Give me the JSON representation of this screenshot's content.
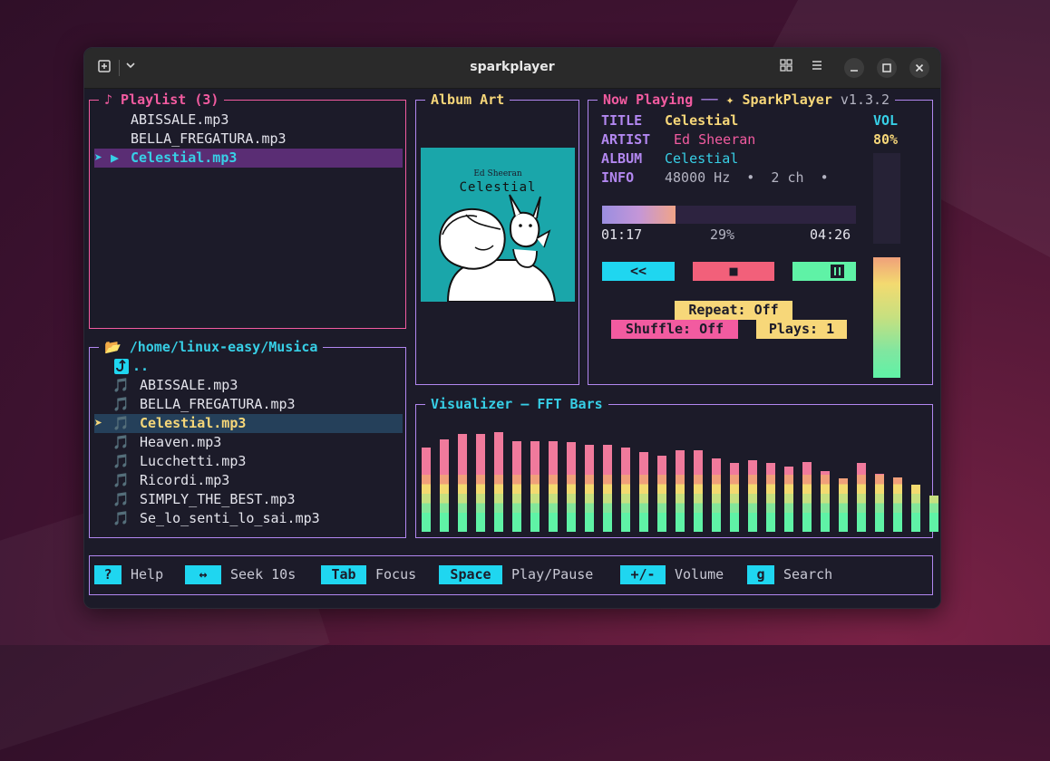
{
  "window": {
    "title": "sparkplayer"
  },
  "playlist": {
    "legend": "♪ Playlist (3)",
    "items": [
      "ABISSALE.mp3",
      "BELLA_FREGATURA.mp3",
      "Celestial.mp3"
    ],
    "selected_marker": "➤ ▶"
  },
  "browser": {
    "legend": "📂 /home/linux-easy/Musica",
    "parent": "..",
    "parent_icon": "return-arrow-icon",
    "files": [
      "ABISSALE.mp3",
      "BELLA_FREGATURA.mp3",
      "Celestial.mp3",
      "Heaven.mp3",
      "Lucchetti.mp3",
      "Ricordi.mp3",
      "SIMPLY_THE_BEST.mp3",
      "Se_lo_senti_lo_sai.mp3"
    ],
    "file_icon": "🎵",
    "cursor": "➤"
  },
  "album": {
    "legend": "Album Art",
    "artist_text": "Ed Sheeran",
    "title_text": "Celestial"
  },
  "now_playing": {
    "legend": "Now Playing",
    "brand": "✦ SparkPlayer",
    "version": "v1.3.2",
    "labels": {
      "title": "TITLE",
      "artist": "ARTIST",
      "album": "ALBUM",
      "info": "INFO"
    },
    "values": {
      "title": "Celestial",
      "artist": "Ed Sheeran",
      "album": "Celestial",
      "info": "48000 Hz  •  2 ch  •"
    },
    "elapsed": "01:17",
    "percent": "29%",
    "duration": "04:26",
    "progress_fraction": 0.29,
    "volume_label": "VOL",
    "volume_value": "80%",
    "volume_fraction": 0.8,
    "controls": {
      "prev": "<<",
      "stop": "■",
      "pause": "⏸"
    },
    "repeat": "Repeat: Off",
    "shuffle": "Shuffle: Off",
    "plays": "Plays: 1"
  },
  "visualizer": {
    "legend": "Visualizer — FFT Bars",
    "levels": [
      0.73,
      0.8,
      0.84,
      0.84,
      0.86,
      0.78,
      0.78,
      0.78,
      0.77,
      0.75,
      0.75,
      0.73,
      0.69,
      0.66,
      0.7,
      0.7,
      0.63,
      0.59,
      0.62,
      0.59,
      0.56,
      0.6,
      0.52,
      0.46,
      0.59,
      0.5,
      0.47,
      0.41,
      0.31
    ]
  },
  "help": [
    {
      "key": "?",
      "label": "Help"
    },
    {
      "key": "↔",
      "label": "Seek 10s"
    },
    {
      "key": "Tab",
      "label": "Focus"
    },
    {
      "key": "Space",
      "label": "Play/Pause"
    },
    {
      "key": "+/-",
      "label": "Volume"
    },
    {
      "key": "g",
      "label": "Search"
    }
  ],
  "colors": {
    "pink": "#f25ba0",
    "yellow": "#f7d779",
    "cyan": "#37cfe6",
    "purple": "#b287f0",
    "green": "#5ff2a6",
    "album_bg": "#1aa6aa"
  }
}
